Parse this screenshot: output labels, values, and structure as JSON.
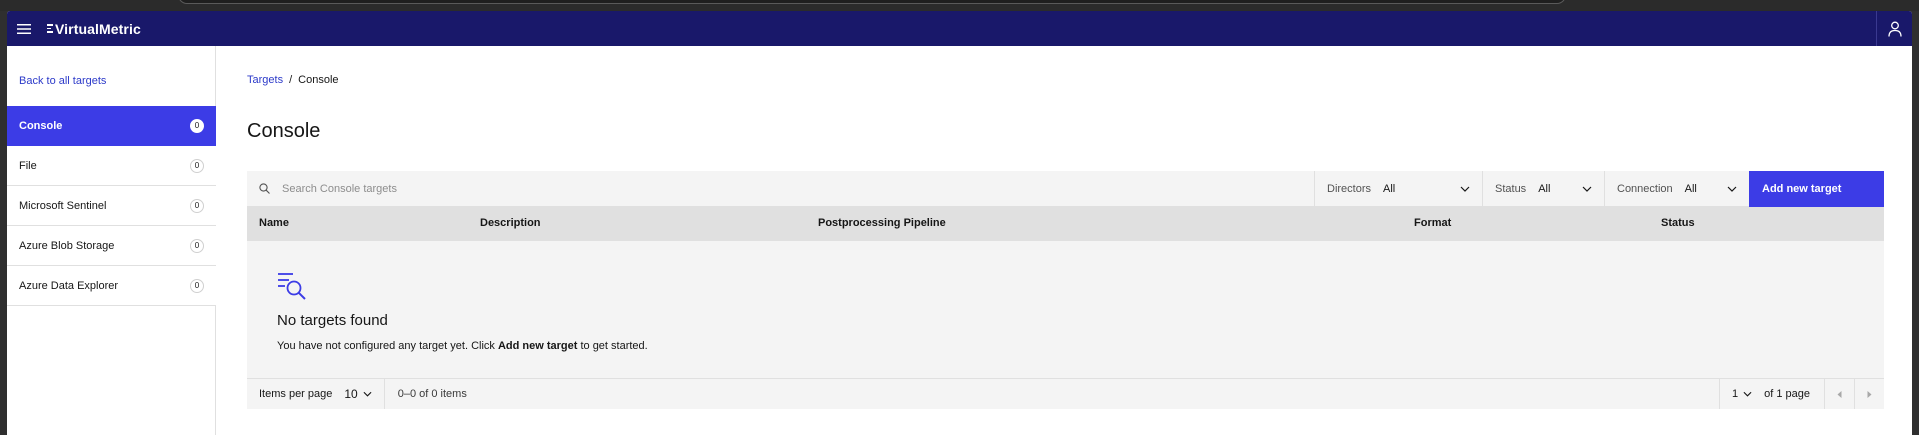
{
  "app": {
    "brand": "VirtualMetric"
  },
  "sidebar": {
    "back_label": "Back to all targets",
    "items": [
      {
        "label": "Console",
        "count": "0"
      },
      {
        "label": "File",
        "count": "0"
      },
      {
        "label": "Microsoft Sentinel",
        "count": "0"
      },
      {
        "label": "Azure Blob Storage",
        "count": "0"
      },
      {
        "label": "Azure Data Explorer",
        "count": "0"
      }
    ]
  },
  "breadcrumb": {
    "parent": "Targets",
    "separator": "/",
    "current": "Console"
  },
  "page": {
    "title": "Console"
  },
  "toolbar": {
    "search_placeholder": "Search Console targets",
    "filters": {
      "directors": {
        "label": "Directors",
        "value": "All"
      },
      "status": {
        "label": "Status",
        "value": "All"
      },
      "connection": {
        "label": "Connection",
        "value": "All"
      }
    },
    "add_label": "Add new target"
  },
  "table": {
    "columns": [
      "Name",
      "Description",
      "Postprocessing Pipeline",
      "Format",
      "Status"
    ]
  },
  "empty": {
    "title": "No targets found",
    "desc_prefix": "You have not configured any target yet. Click ",
    "desc_bold": "Add new target",
    "desc_suffix": " to get started."
  },
  "pagination": {
    "items_per_page_label": "Items per page",
    "items_per_page_value": "10",
    "range_text": "0–0 of 0 items",
    "page_value": "1",
    "of_pages": "of 1 page"
  },
  "colors": {
    "header": "#19186a",
    "accent": "#3c3ce6",
    "link": "#2c3ac9"
  },
  "icons": [
    "menu-icon",
    "user-icon",
    "search-icon",
    "chevron-down-icon",
    "search-list-icon",
    "caret-left-icon",
    "caret-right-icon"
  ]
}
